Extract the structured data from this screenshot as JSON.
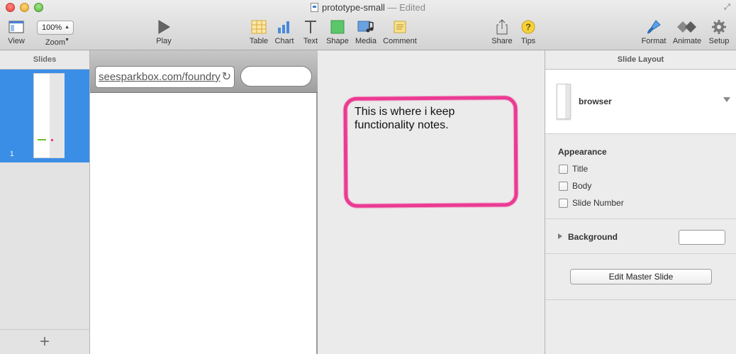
{
  "window": {
    "doc_name": "prototype-small",
    "doc_status": "— Edited"
  },
  "toolbar": {
    "view_label": "View",
    "zoom_label": "Zoom",
    "zoom_value": "100%",
    "play_label": "Play",
    "table_label": "Table",
    "chart_label": "Chart",
    "text_label": "Text",
    "shape_label": "Shape",
    "media_label": "Media",
    "comment_label": "Comment",
    "share_label": "Share",
    "tips_label": "Tips",
    "format_label": "Format",
    "animate_label": "Animate",
    "setup_label": "Setup"
  },
  "navigator": {
    "header": "Slides",
    "slides": [
      {
        "number": "1"
      }
    ],
    "add_symbol": "+"
  },
  "canvas": {
    "url": "seesparkbox.com/foundry",
    "note_text": "This is where i keep functionality notes."
  },
  "inspector": {
    "header": "Slide Layout",
    "layout_name": "browser",
    "appearance_title": "Appearance",
    "options": [
      {
        "label": "Title",
        "checked": false
      },
      {
        "label": "Body",
        "checked": false
      },
      {
        "label": "Slide Number",
        "checked": false
      }
    ],
    "background_label": "Background",
    "edit_master_label": "Edit Master Slide"
  },
  "colors": {
    "accent_blue": "#3a8ee6",
    "note_pink": "#ec3a93",
    "thumb_green": "#6bbf2a"
  }
}
